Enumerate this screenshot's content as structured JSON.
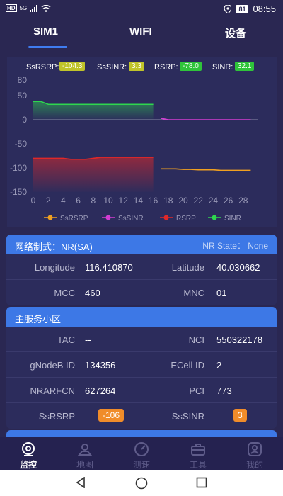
{
  "statusbar": {
    "left_hd": "HD",
    "left_sig": "5G",
    "battery": "81",
    "time": "08:55"
  },
  "tabs": [
    {
      "label": "SIM1"
    },
    {
      "label": "WIFI"
    },
    {
      "label": "设备"
    }
  ],
  "badges": [
    {
      "label": "SsRSRP:",
      "value": "-104.3",
      "color": "#c0c42a"
    },
    {
      "label": "SsSINR:",
      "value": "3.3",
      "color": "#c0c42a"
    },
    {
      "label": "RSRP:",
      "value": "-78.0",
      "color": "#2fc43a"
    },
    {
      "label": "SINR:",
      "value": "32.1",
      "color": "#2fc43a"
    }
  ],
  "chart_data": {
    "type": "line",
    "title": "",
    "xlabel": "",
    "ylabel": "",
    "x_ticks": [
      "0",
      "2",
      "4",
      "6",
      "8",
      "10",
      "12",
      "14",
      "16",
      "18",
      "20",
      "22",
      "24",
      "26",
      "28"
    ],
    "y_ticks": [
      "80",
      "50",
      "0",
      "-50",
      "-100",
      "-150"
    ],
    "xlim": [
      0,
      30
    ],
    "ylim": [
      -150,
      80
    ],
    "legend": [
      "SsRSRP",
      "SsSINR",
      "RSRP",
      "SINR"
    ],
    "legend_position": "bottom",
    "series": [
      {
        "name": "SsRSRP",
        "color": "#f0a020",
        "x": [
          17,
          18,
          19,
          20,
          21,
          22,
          23,
          24,
          25,
          26,
          27,
          28,
          29
        ],
        "y": [
          -102,
          -102,
          -102,
          -103,
          -103,
          -104,
          -104,
          -104,
          -105,
          -105,
          -105,
          -105,
          -105
        ]
      },
      {
        "name": "SsSINR",
        "color": "#d23cd2",
        "x": [
          17,
          18,
          19,
          20,
          21,
          22,
          23,
          24,
          25,
          26,
          27,
          28,
          29
        ],
        "y": [
          3,
          0,
          0,
          0,
          0,
          0,
          0,
          0,
          0,
          0,
          0,
          0,
          0
        ]
      },
      {
        "name": "RSRP",
        "color": "#e02828",
        "x": [
          0,
          1,
          2,
          3,
          4,
          5,
          6,
          7,
          8,
          9,
          10,
          11,
          12,
          13,
          14,
          15,
          16
        ],
        "y": [
          -80,
          -80,
          -80,
          -80,
          -80,
          -82,
          -82,
          -82,
          -80,
          -78,
          -78,
          -78,
          -78,
          -78,
          -78,
          -78,
          -78
        ]
      },
      {
        "name": "SINR",
        "color": "#2ed64e",
        "x": [
          0,
          1,
          2,
          3,
          4,
          5,
          6,
          7,
          8,
          9,
          10,
          11,
          12,
          13,
          14,
          15,
          16
        ],
        "y": [
          38,
          38,
          32,
          32,
          32,
          32,
          32,
          32,
          32,
          32,
          32,
          32,
          32,
          32,
          32,
          32,
          32
        ]
      }
    ]
  },
  "network_card": {
    "title": "网络制式：NR(SA)",
    "nr_state": "NR State： None",
    "rows": [
      {
        "l_label": "Longitude",
        "l_value": "116.410870",
        "r_label": "Latitude",
        "r_value": "40.030662"
      },
      {
        "l_label": "MCC",
        "l_value": "460",
        "r_label": "MNC",
        "r_value": "01"
      }
    ]
  },
  "cell_card": {
    "title": "主服务小区",
    "rows": [
      {
        "l_label": "TAC",
        "l_value": "--",
        "r_label": "NCI",
        "r_value": "550322178"
      },
      {
        "l_label": "gNodeB ID",
        "l_value": "134356",
        "r_label": "ECell ID",
        "r_value": "2"
      },
      {
        "l_label": "NRARFCN",
        "l_value": "627264",
        "r_label": "PCI",
        "r_value": "773"
      },
      {
        "l_label": "SsRSRP",
        "l_value": "-106",
        "r_label": "SsSINR",
        "r_value": "3"
      }
    ]
  },
  "bottom_nav": [
    {
      "label": "监控",
      "icon": "monitor-icon",
      "active": true
    },
    {
      "label": "地图",
      "icon": "map-icon",
      "active": false
    },
    {
      "label": "测速",
      "icon": "speed-icon",
      "active": false
    },
    {
      "label": "工具",
      "icon": "toolbox-icon",
      "active": false
    },
    {
      "label": "我的",
      "icon": "profile-icon",
      "active": false
    }
  ]
}
